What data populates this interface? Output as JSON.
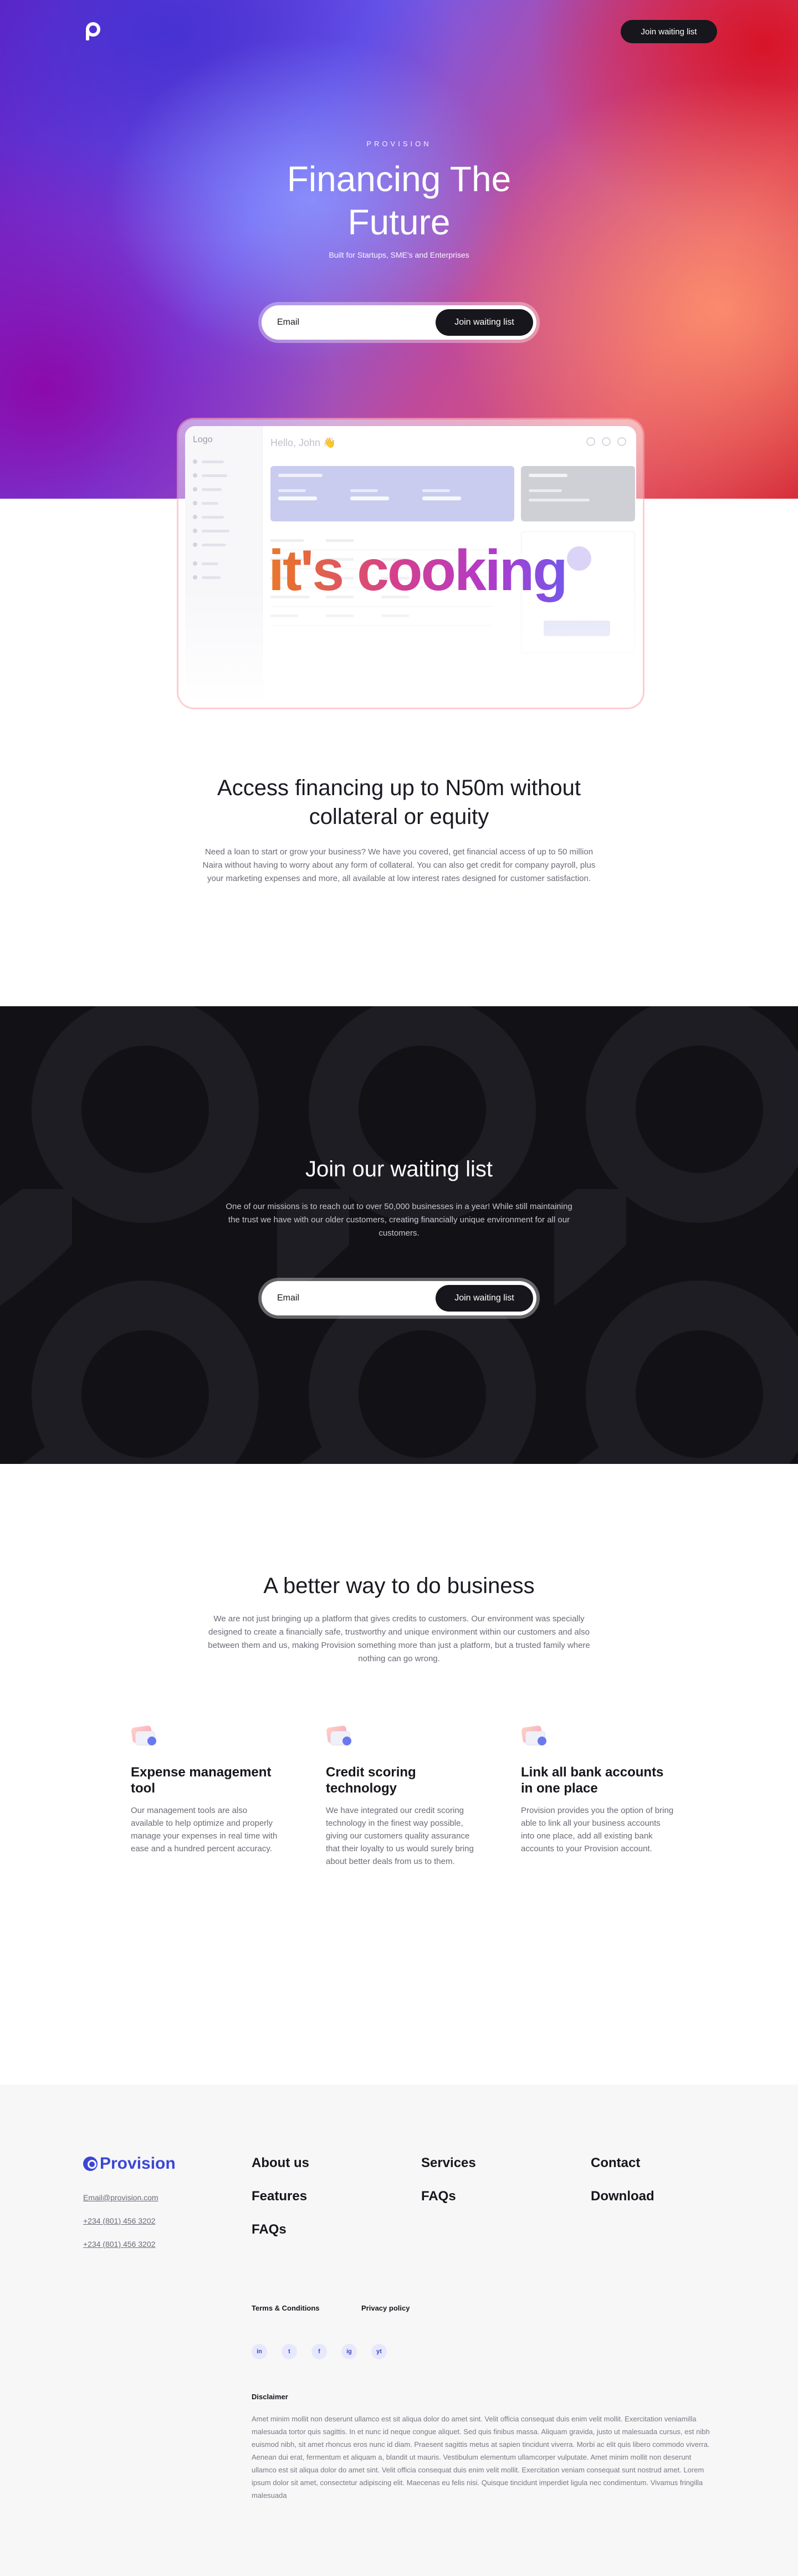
{
  "header": {
    "cta_label": "Join waiting list",
    "logo_icon": "provision-logo-icon"
  },
  "hero": {
    "eyebrow": "PROVISION",
    "title": "Financing The Future",
    "subtitle": "Built for Startups, SME's and Enterprises",
    "email_placeholder": "Email",
    "button_label": "Join waiting list"
  },
  "mockup": {
    "logo": "Logo",
    "greeting": "Hello, John 👋",
    "overlay_text": "it's cooking"
  },
  "access": {
    "title": "Access financing up to N50m without collateral or equity",
    "body": "Need a loan to start or grow your business? We have you covered, get financial access of up to 50 million Naira without having to worry about any form of collateral. You can also get credit for company payroll, plus your marketing expenses and  more, all available at low interest rates designed for customer satisfaction."
  },
  "waitlist": {
    "title": "Join our waiting list",
    "body": "One of our missions is to reach out to over 50,000 businesses in a year! While still maintaining the trust we have with our older customers, creating financially unique environment for all our customers.",
    "email_placeholder": "Email",
    "button_label": "Join waiting list"
  },
  "better": {
    "title": "A better way to do business",
    "body": "We are not just bringing up a platform that gives credits to customers. Our environment was specially designed to create a financially safe, trustworthy and unique environment within our customers and also between them and us, making Provision something more than just a platform, but a trusted family where nothing can go wrong."
  },
  "features": [
    {
      "title": "Expense management tool",
      "body": "Our management tools are also available to help optimize and properly manage your expenses in real time with ease and a hundred percent accuracy."
    },
    {
      "title": "Credit scoring technology",
      "body": "We have integrated our credit scoring technology in the finest way possible, giving our customers quality assurance that their loyalty to us would surely bring about better deals from us to them."
    },
    {
      "title": "Link all bank accounts in one place",
      "body": "Provision provides you the option of bring able to link all your business accounts into one place, add all existing bank accounts to your Provision account."
    }
  ],
  "footer": {
    "brand": "Provision",
    "email": "Email@provision.com",
    "phone1": "+234 (801) 456 3202",
    "phone2": "+234 (801) 456 3202",
    "col1": [
      "About us",
      "Features",
      "FAQs"
    ],
    "col2": [
      "Services",
      "FAQs"
    ],
    "col3": [
      "Contact",
      "Download"
    ],
    "terms": "Terms & Conditions",
    "privacy": "Privacy policy",
    "social": [
      "in",
      "t",
      "f",
      "ig",
      "yt"
    ],
    "disclaimer_title": "Disclaimer",
    "disclaimer": "Amet minim mollit non deserunt ullamco est sit aliqua dolor do amet sint. Velit officia consequat duis enim velit mollit. Exercitation veniamilla malesuada tortor quis sagittis. In et nunc id neque congue aliquet. Sed quis finibus massa. Aliquam gravida, justo ut malesuada cursus, est nibh euismod nibh, sit amet rhoncus eros nunc id diam. Praesent sagittis metus at sapien tincidunt viverra. Morbi ac elit quis libero commodo viverra. Aenean dui erat, fermentum et aliquam a, blandit ut mauris. Vestibulum elementum ullamcorper vulputate. Amet minim mollit non deserunt ullamco est sit aliqua dolor do amet sint. Velit officia consequat duis enim velit mollit. Exercitation veniam consequat sunt nostrud amet. Lorem ipsum dolor sit amet, consectetur adipiscing elit. Maecenas eu felis nisi. Quisque tincidunt imperdiet ligula nec condimentum. Vivamus fringilla malesuada"
  },
  "colors": {
    "brand_blue": "#3b46d6",
    "dark": "#16161c",
    "dark_section": "#121216"
  }
}
